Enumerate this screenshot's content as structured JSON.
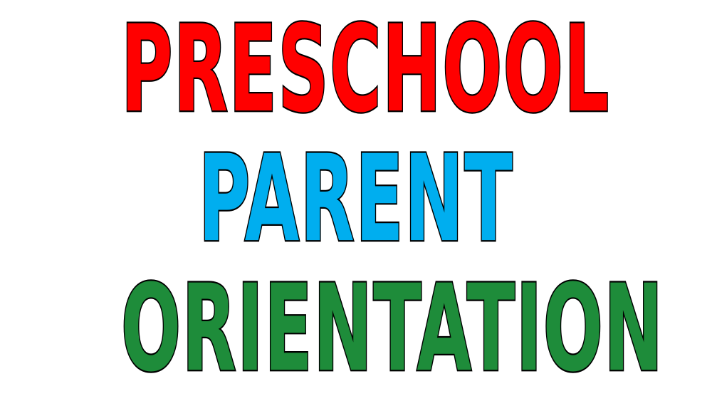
{
  "headline": {
    "line1": "PRESCHOOL",
    "line2": "PARENT",
    "line3": "ORIENTATION"
  },
  "colors": {
    "line1": "#ff0000",
    "line2": "#00aeef",
    "line3": "#1e8c3a",
    "outline": "#000000",
    "background": "#ffffff"
  }
}
